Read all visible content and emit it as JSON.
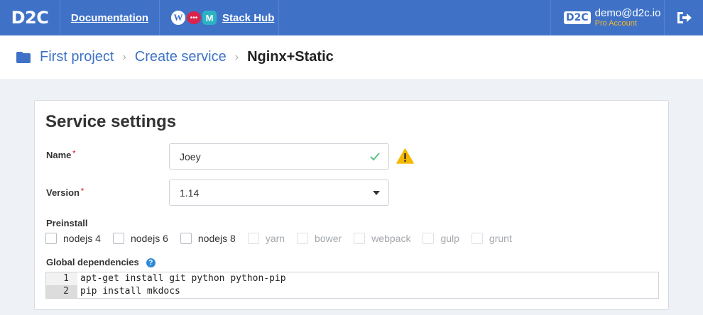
{
  "topbar": {
    "logo": "D2C",
    "documentation_label": "Documentation",
    "stackhub_label": "Stack Hub",
    "stack_icons": [
      "wordpress-icon",
      "chat-bubble-icon",
      "m-logo-icon"
    ],
    "account": {
      "logo": "D2C",
      "email": "demo@d2c.io",
      "plan": "Pro Account"
    },
    "logout_icon": "logout-icon",
    "colors": {
      "bar": "#3f72c7",
      "plan": "#f5b72b"
    }
  },
  "breadcrumb": {
    "folder_icon": "folder-icon",
    "items": [
      "First project",
      "Create service"
    ],
    "current": "Nginx+Static"
  },
  "form": {
    "title": "Service settings",
    "name_label": "Name",
    "name_value": "Joey",
    "version_label": "Version",
    "version_value": "1.14",
    "required_mark": "*",
    "preinstall_label": "Preinstall",
    "preinstall_options": [
      {
        "label": "nodejs 4",
        "enabled": true
      },
      {
        "label": "nodejs 6",
        "enabled": true
      },
      {
        "label": "nodejs 8",
        "enabled": true
      },
      {
        "label": "yarn",
        "enabled": false
      },
      {
        "label": "bower",
        "enabled": false
      },
      {
        "label": "webpack",
        "enabled": false
      },
      {
        "label": "gulp",
        "enabled": false
      },
      {
        "label": "grunt",
        "enabled": false
      }
    ],
    "global_deps_label": "Global dependencies",
    "help_glyph": "?",
    "editor_lines": [
      {
        "num": "1",
        "text": "apt-get install git python python-pip"
      },
      {
        "num": "2",
        "text": "pip install mkdocs"
      }
    ],
    "colors": {
      "valid": "#5cc28a",
      "warning": "#f5b800",
      "required": "#e2333f"
    }
  }
}
